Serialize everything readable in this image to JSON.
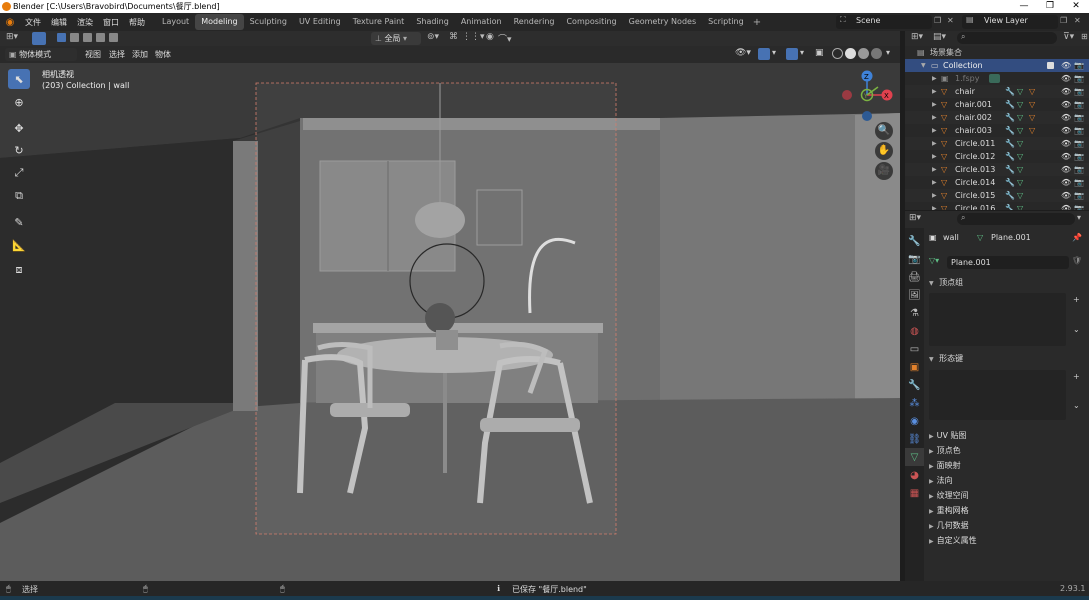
{
  "window": {
    "title": "Blender [C:\\Users\\Bravobird\\Documents\\餐厅.blend]"
  },
  "menus": [
    "文件",
    "编辑",
    "渲染",
    "窗口",
    "帮助"
  ],
  "workspaces": [
    {
      "label": "Layout",
      "active": false
    },
    {
      "label": "Modeling",
      "active": true
    },
    {
      "label": "Sculpting",
      "active": false
    },
    {
      "label": "UV Editing",
      "active": false
    },
    {
      "label": "Texture Paint",
      "active": false
    },
    {
      "label": "Shading",
      "active": false
    },
    {
      "label": "Animation",
      "active": false
    },
    {
      "label": "Rendering",
      "active": false
    },
    {
      "label": "Compositing",
      "active": false
    },
    {
      "label": "Geometry Nodes",
      "active": false
    },
    {
      "label": "Scripting",
      "active": false
    }
  ],
  "scene": {
    "label": "Scene"
  },
  "view_layer": {
    "label": "View Layer"
  },
  "viewport": {
    "mode": "物体模式",
    "menus": [
      "视图",
      "选择",
      "添加",
      "物体"
    ],
    "overlay_line1": "相机透视",
    "overlay_line2": "(203) Collection | wall",
    "transform_orientation": "全局",
    "xray_label": "透视",
    "gizmo_axes": {
      "x": "X",
      "y": "Y",
      "z": "Z"
    }
  },
  "outliner": {
    "title": "场景集合",
    "collection": "Collection",
    "items": [
      "1.fspy",
      "chair",
      "chair.001",
      "chair.002",
      "chair.003",
      "Circle.011",
      "Circle.012",
      "Circle.013",
      "Circle.014",
      "Circle.015",
      "Circle.016"
    ]
  },
  "properties": {
    "object_name": "wall",
    "mesh_name": "Plane.001",
    "data_field": "Plane.001",
    "sections_open": [
      "顶点组",
      "形态键"
    ],
    "sections_closed": [
      "UV 贴图",
      "顶点色",
      "面映射",
      "法向",
      "纹理空间",
      "重构网格",
      "几何数据",
      "自定义属性"
    ]
  },
  "statusbar": {
    "left": "选择",
    "message": "已保存 \"餐厅.blend\"",
    "version": "2.93.1"
  },
  "colors": {
    "accent": "#4772b3",
    "active_ws": "#454545",
    "orange": "#e3822c",
    "green": "#5fbf86",
    "x_axis": "#e0414e",
    "y_axis": "#7cb342",
    "z_axis": "#3f82d8"
  }
}
